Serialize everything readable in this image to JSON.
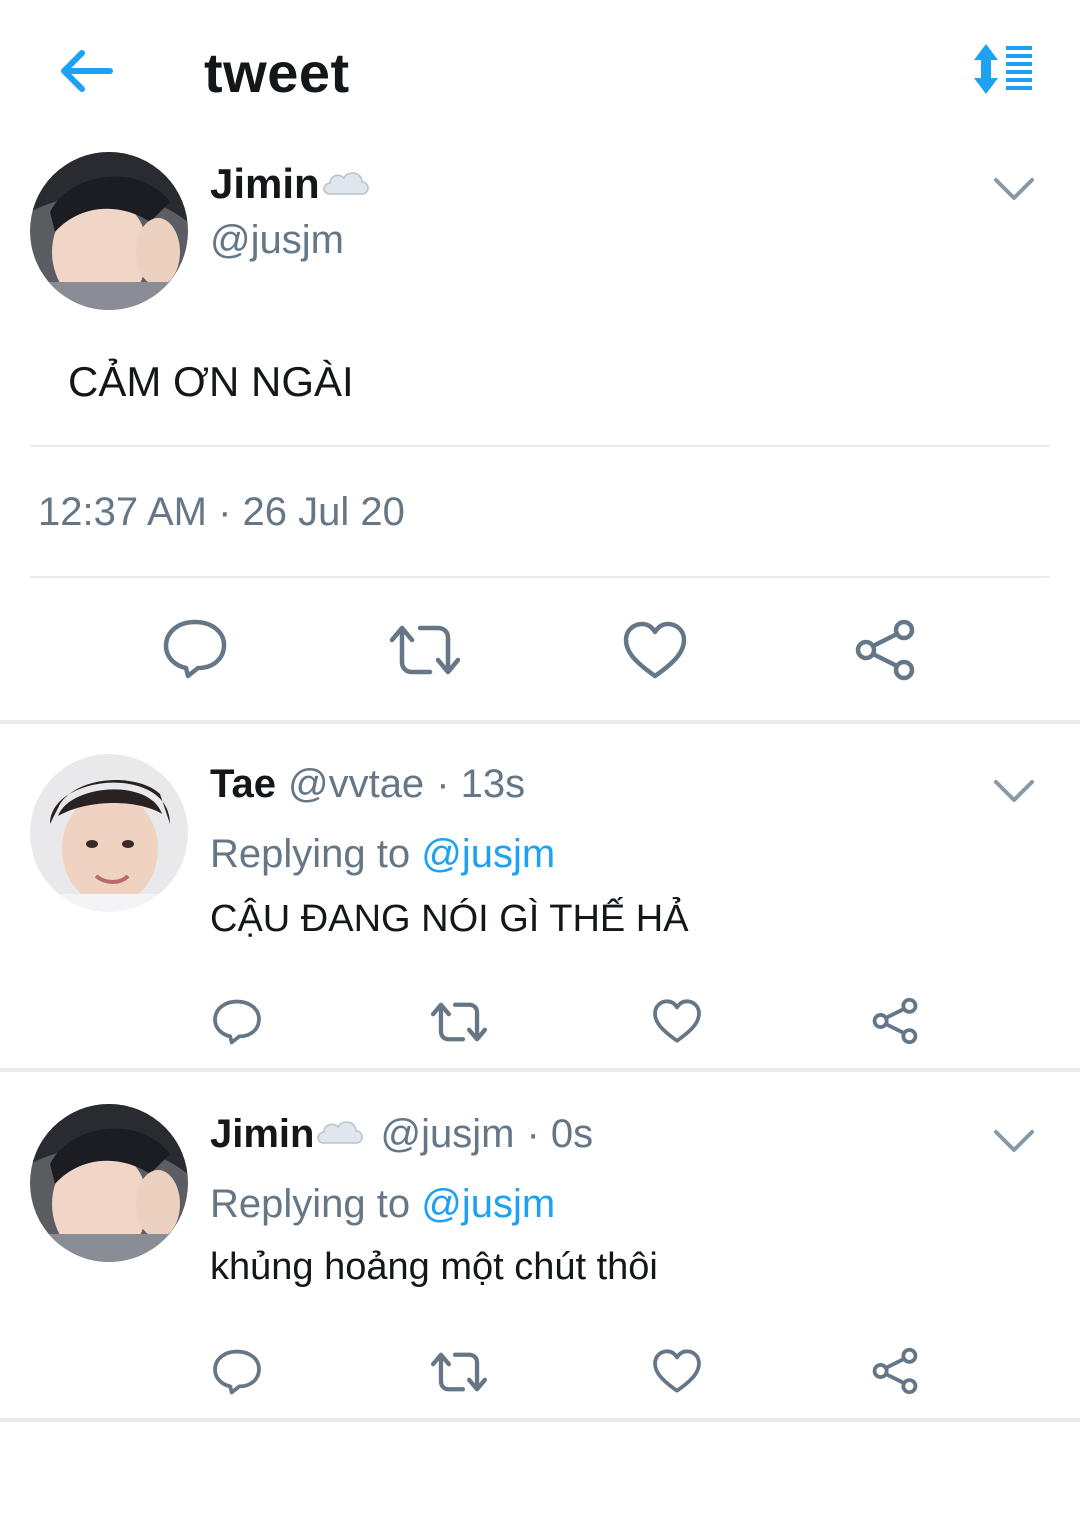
{
  "header": {
    "title": "tweet",
    "back_icon": "arrow-left-icon",
    "sort_icon": "sort-list-icon",
    "accent_color": "#1da1f2"
  },
  "main_tweet": {
    "display_name": "Jimin",
    "name_emoji": "cloud-icon",
    "handle": "@jusjm",
    "text": "CẢM ƠN NGÀI",
    "timestamp": "12:37 AM · 26 Jul 20",
    "actions": [
      "reply-icon",
      "retweet-icon",
      "like-icon",
      "share-icon"
    ]
  },
  "replies": [
    {
      "display_name": "Tae",
      "handle": "@vvtae",
      "time": "· 13s",
      "replying_label": "Replying to",
      "replying_handle": "@jusjm",
      "text": "CẬU ĐANG NÓI GÌ THẾ HẢ"
    },
    {
      "display_name": "Jimin",
      "name_emoji": "cloud-icon",
      "handle": "@jusjm",
      "time": "· 0s",
      "replying_label": "Replying to",
      "replying_handle": "@jusjm",
      "text": "khủng hoảng một chút thôi"
    }
  ]
}
